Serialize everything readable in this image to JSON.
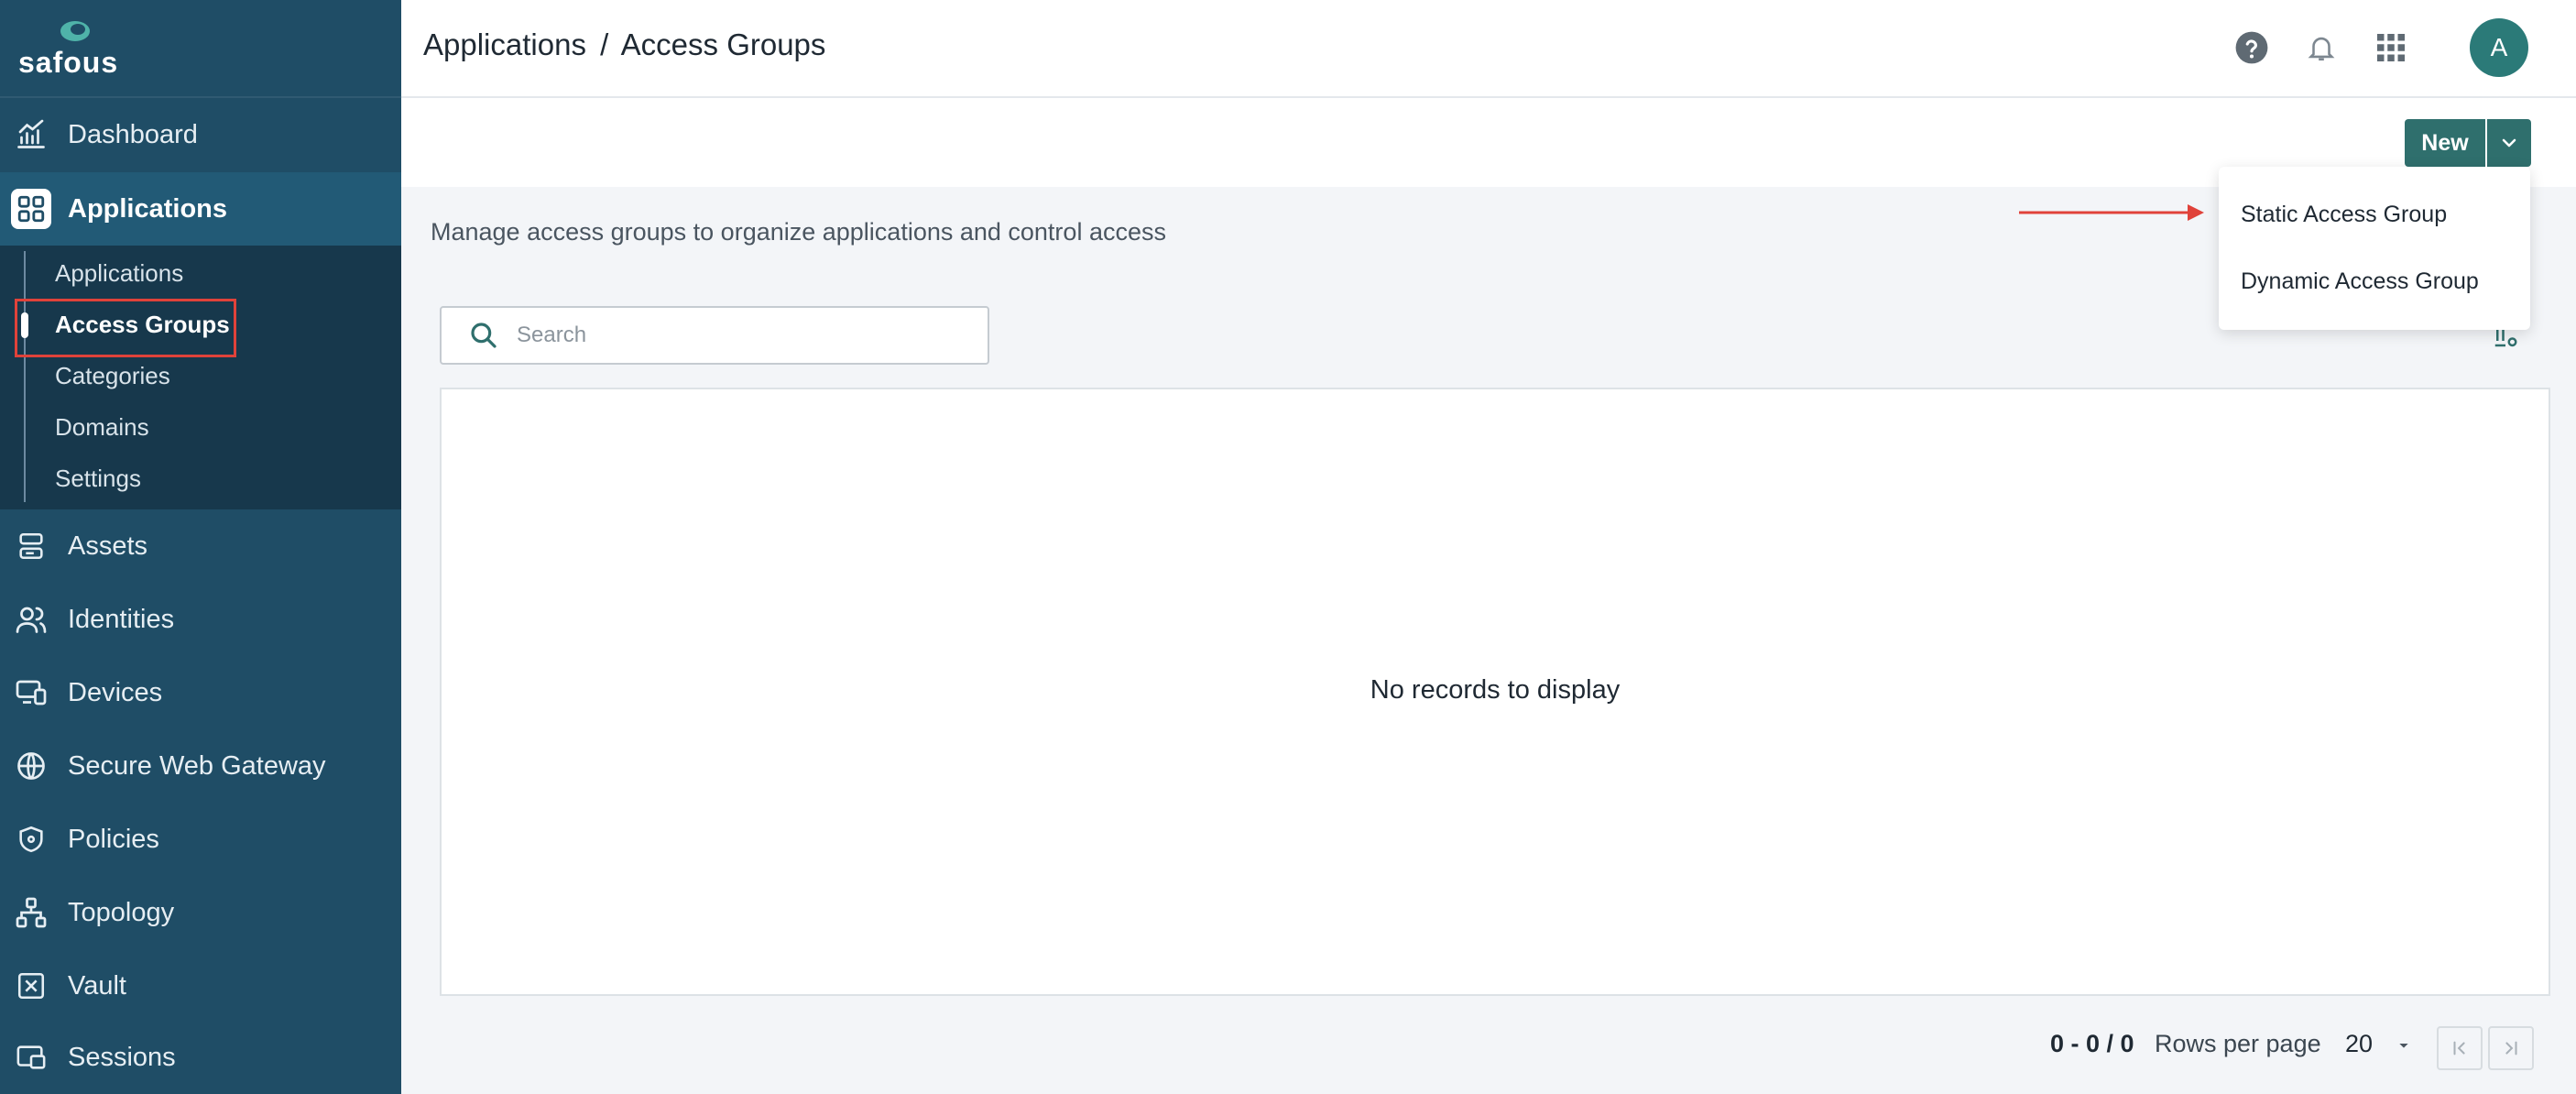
{
  "brand": {
    "name": "safous",
    "logo_color": "#4fb3a9"
  },
  "sidebar": {
    "items": [
      {
        "label": "Dashboard",
        "icon": "chart-icon"
      },
      {
        "label": "Applications",
        "icon": "grid-icon",
        "active": true
      },
      {
        "label": "Assets",
        "icon": "server-icon"
      },
      {
        "label": "Identities",
        "icon": "users-icon"
      },
      {
        "label": "Devices",
        "icon": "devices-icon"
      },
      {
        "label": "Secure Web Gateway",
        "icon": "globe-icon"
      },
      {
        "label": "Policies",
        "icon": "shield-icon"
      },
      {
        "label": "Topology",
        "icon": "topology-icon"
      },
      {
        "label": "Vault",
        "icon": "vault-icon"
      },
      {
        "label": "Sessions",
        "icon": "sessions-icon"
      }
    ],
    "subitems": [
      {
        "label": "Applications"
      },
      {
        "label": "Access Groups",
        "active": true
      },
      {
        "label": "Categories"
      },
      {
        "label": "Domains"
      },
      {
        "label": "Settings"
      }
    ]
  },
  "header": {
    "breadcrumb_parent": "Applications",
    "breadcrumb_separator": "/",
    "breadcrumb_current": "Access Groups",
    "avatar_initial": "A"
  },
  "toolbar": {
    "new_label": "New"
  },
  "new_menu": {
    "items": [
      "Static Access Group",
      "Dynamic Access Group"
    ]
  },
  "main": {
    "description": "Manage access groups to organize applications and control access",
    "search_placeholder": "Search",
    "empty_message": "No records to display"
  },
  "pagination": {
    "range": "0 - 0 / 0",
    "rows_per_page_label": "Rows per page",
    "rows_per_page_value": "20"
  },
  "colors": {
    "sidebar_bg": "#1f4d66",
    "subnav_bg": "#17384c",
    "accent": "#2f6f6d",
    "annotation_red": "#e0423a"
  }
}
